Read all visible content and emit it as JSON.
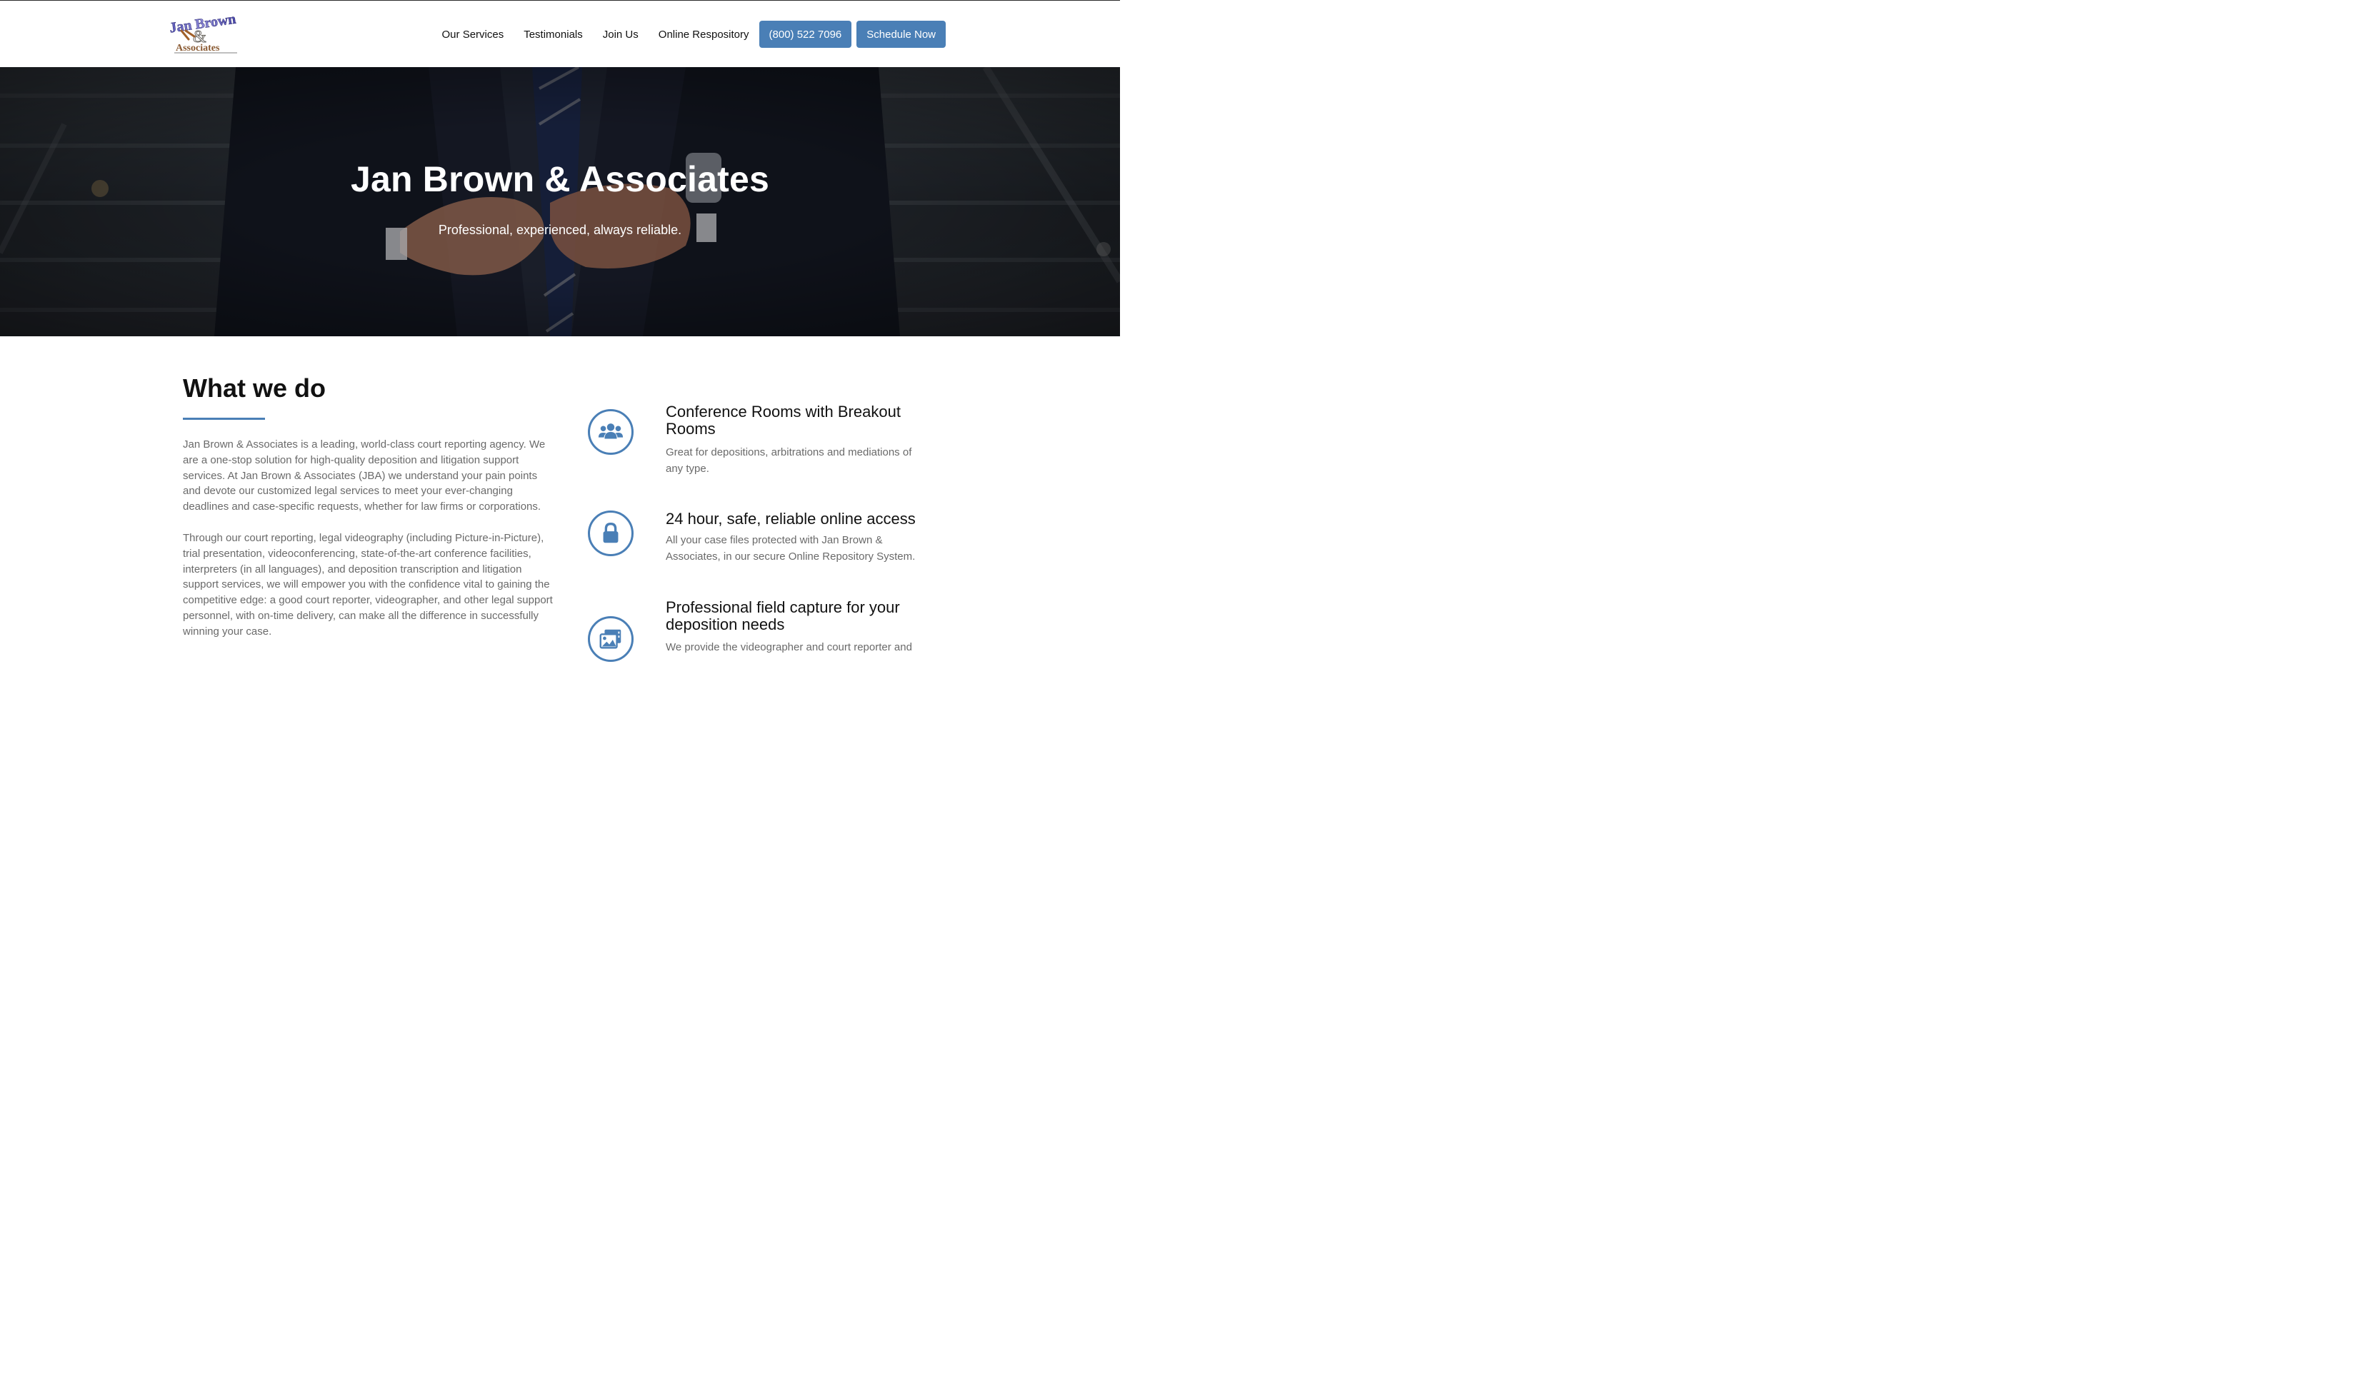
{
  "brand": {
    "logo_line1": "Jan Brown",
    "logo_amp": "&",
    "logo_line2": "Associates"
  },
  "nav": {
    "links": [
      "Our Services",
      "Testimonials",
      "Join Us",
      "Online Respository"
    ],
    "phone_label": "(800) 522 7096",
    "schedule_label": "Schedule Now"
  },
  "hero": {
    "title": "Jan Brown & Associates",
    "subtitle": "Professional, experienced, always reliable."
  },
  "what_we_do": {
    "title": "What we do",
    "paragraphs": [
      "Jan Brown & Associates is a leading, world-class court reporting agency. We are a one-stop solution for high-quality deposition and litigation support services. At Jan Brown & Associates (JBA) we understand your pain points and devote our customized legal services to meet your ever-changing deadlines and case-specific requests, whether for law firms or corporations.",
      "Through our court reporting, legal videography (including Picture-in-Picture), trial presentation, videoconferencing, state-of-the-art conference facilities, interpreters (in all languages), and deposition transcription and litigation support services, we will empower you with the confidence vital to gaining the competitive edge: a good court reporter, videographer, and other legal support personnel, with on-time delivery, can make all the difference in successfully winning your case."
    ]
  },
  "features": [
    {
      "icon": "users-icon",
      "title": "Conference Rooms with Breakout Rooms",
      "desc": "Great for depositions, arbitrations and mediations of any type."
    },
    {
      "icon": "lock-icon",
      "title": "24 hour, safe, reliable online access",
      "desc": "All your case files protected with Jan Brown & Associates, in our secure Online Repository System."
    },
    {
      "icon": "photo-video-icon",
      "title": "Professional field capture for your deposition needs",
      "desc": "We provide the videographer and court reporter and"
    }
  ],
  "colors": {
    "accent": "#4a7fb6",
    "body_text": "#6a6a6a"
  }
}
